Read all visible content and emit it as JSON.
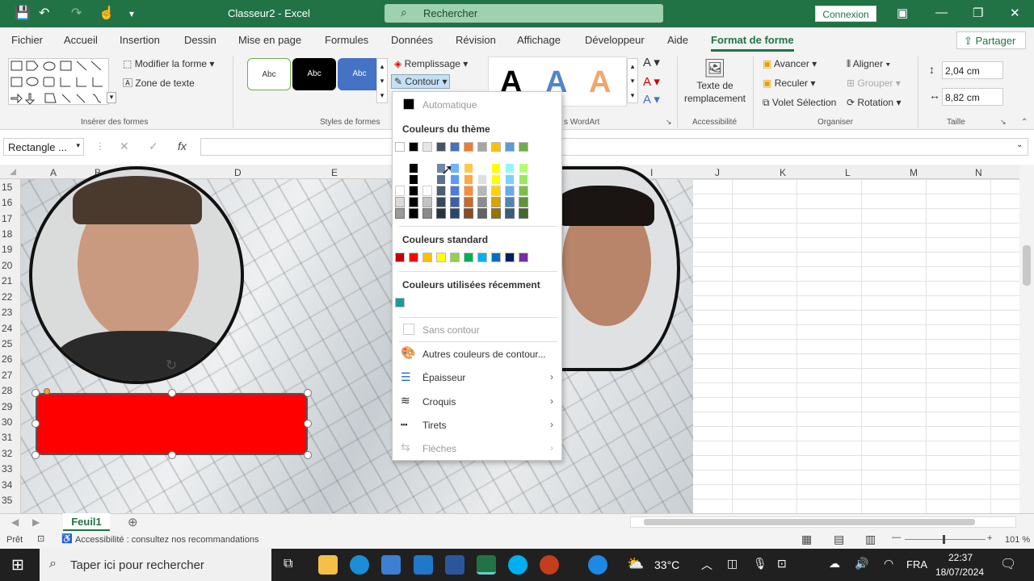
{
  "titlebar": {
    "title": "Classeur2  -  Excel",
    "search_placeholder": "Rechercher",
    "connexion": "Connexion"
  },
  "tabs": [
    "Fichier",
    "Accueil",
    "Insertion",
    "Dessin",
    "Mise en page",
    "Formules",
    "Données",
    "Révision",
    "Affichage",
    "Développeur",
    "Aide",
    "Format de forme"
  ],
  "active_tab": "Format de forme",
  "share": "Partager",
  "ribbon": {
    "modifier_forme": "Modifier la forme",
    "zone_texte": "Zone de texte",
    "inserer_formes": "Insérer des formes",
    "style_sample": "Abc",
    "styles_formes": "Styles de formes",
    "remplissage": "Remplissage",
    "contour": "Contour",
    "wordart": "s WordArt",
    "texte_remplacement": "Texte de remplacement",
    "accessibilite": "Accessibilité",
    "avancer": "Avancer",
    "reculer": "Reculer",
    "volet_selection": "Volet Sélection",
    "aligner": "Aligner",
    "grouper": "Grouper",
    "rotation": "Rotation",
    "organiser": "Organiser",
    "height": "2,04 cm",
    "width": "8,82 cm",
    "taille": "Taille"
  },
  "formula": {
    "namebox": "Rectangle ...",
    "fx": "fx"
  },
  "columns": [
    "A",
    "B",
    "C",
    "D",
    "E",
    "H",
    "I",
    "J",
    "K",
    "L",
    "M",
    "N"
  ],
  "rows": [
    "15",
    "16",
    "17",
    "18",
    "19",
    "20",
    "21",
    "22",
    "23",
    "24",
    "25",
    "26",
    "27",
    "28",
    "29",
    "30",
    "31",
    "32",
    "33",
    "34",
    "35"
  ],
  "dropdown": {
    "automatique": "Automatique",
    "theme_title": "Couleurs du thème",
    "theme_colors": [
      "#ffffff",
      "#000000",
      "#e7e6e6",
      "#44546a",
      "#4472c4",
      "#ed7d31",
      "#a5a5a5",
      "#ffc000",
      "#5b9bd5",
      "#70ad47"
    ],
    "standard_title": "Couleurs standard",
    "standard_colors": [
      "#c00000",
      "#ff0000",
      "#ffc000",
      "#ffff00",
      "#92d050",
      "#00b050",
      "#00b0f0",
      "#0070c0",
      "#002060",
      "#7030a0"
    ],
    "recent_title": "Couleurs utilisées récemment",
    "recent_colors": [
      "#1b9aa0"
    ],
    "sans_contour": "Sans contour",
    "autres": "Autres couleurs de contour...",
    "epaisseur": "Épaisseur",
    "croquis": "Croquis",
    "tirets": "Tirets",
    "fleches": "Flèches"
  },
  "sheet": {
    "tab": "Feuil1"
  },
  "status": {
    "ready": "Prêt",
    "accessibility": "Accessibilité : consultez nos recommandations",
    "zoom": "101 %"
  },
  "taskbar": {
    "search": "Taper ici pour rechercher",
    "temp": "33°C",
    "lang": "FRA",
    "time": "22:37",
    "date": "18/07/2024"
  }
}
